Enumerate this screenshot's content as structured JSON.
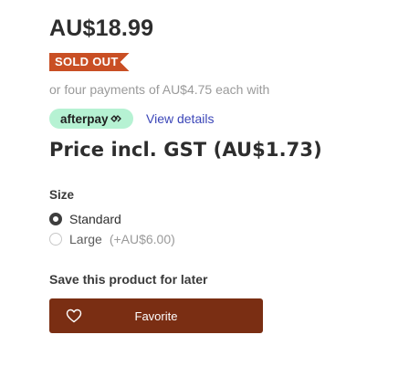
{
  "product": {
    "price": "AU$18.99",
    "stock_badge": "SOLD OUT",
    "installments_text": "or four payments of AU$4.75 each with",
    "afterpay": {
      "logo_text": "afterpay",
      "view_details": "View details"
    },
    "price_incl_gst": "Price incl. GST (AU$1.73)"
  },
  "size": {
    "label": "Size",
    "options": [
      {
        "label": "Standard",
        "extra": "",
        "selected": true
      },
      {
        "label": "Large",
        "extra": "(+AU$6.00)",
        "selected": false
      }
    ]
  },
  "save": {
    "label": "Save this product for later",
    "button_label": "Favorite",
    "icon": "heart-icon"
  },
  "colors": {
    "sold_out": "#c94f24",
    "afterpay_mint": "#b6f2d3",
    "link": "#3b46b8",
    "favorite_button": "#7a2e13"
  }
}
